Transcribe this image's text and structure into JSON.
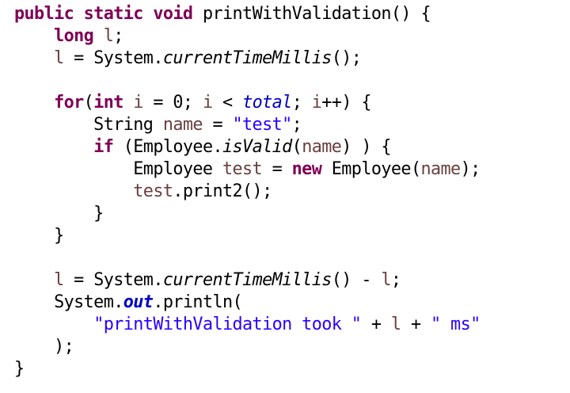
{
  "editor": {
    "lines": [
      [
        {
          "t": "public",
          "c": "kw"
        },
        {
          "t": " "
        },
        {
          "t": "static",
          "c": "kw"
        },
        {
          "t": " "
        },
        {
          "t": "void",
          "c": "kw"
        },
        {
          "t": " printWithValidation() {"
        }
      ],
      [
        {
          "t": "    "
        },
        {
          "t": "long",
          "c": "kw"
        },
        {
          "t": " "
        },
        {
          "t": "l",
          "c": "var"
        },
        {
          "t": ";"
        }
      ],
      [
        {
          "t": "    "
        },
        {
          "t": "l",
          "c": "var"
        },
        {
          "t": " = System."
        },
        {
          "t": "currentTimeMillis",
          "c": "smethod"
        },
        {
          "t": "();"
        }
      ],
      [],
      [
        {
          "t": "    "
        },
        {
          "t": "for",
          "c": "kw"
        },
        {
          "t": "("
        },
        {
          "t": "int",
          "c": "kw"
        },
        {
          "t": " "
        },
        {
          "t": "i",
          "c": "var"
        },
        {
          "t": " = 0; "
        },
        {
          "t": "i",
          "c": "var"
        },
        {
          "t": " < "
        },
        {
          "t": "total",
          "c": "field"
        },
        {
          "t": "; "
        },
        {
          "t": "i",
          "c": "var"
        },
        {
          "t": "++) {"
        }
      ],
      [
        {
          "t": "        String "
        },
        {
          "t": "name",
          "c": "var"
        },
        {
          "t": " = "
        },
        {
          "t": "\"test\"",
          "c": "str"
        },
        {
          "t": ";"
        }
      ],
      [
        {
          "t": "        "
        },
        {
          "t": "if",
          "c": "kw"
        },
        {
          "t": " (Employee."
        },
        {
          "t": "isValid",
          "c": "smethod"
        },
        {
          "t": "("
        },
        {
          "t": "name",
          "c": "var"
        },
        {
          "t": ") ) {"
        }
      ],
      [
        {
          "t": "            Employee "
        },
        {
          "t": "test",
          "c": "var"
        },
        {
          "t": " = "
        },
        {
          "t": "new",
          "c": "kw"
        },
        {
          "t": " Employee("
        },
        {
          "t": "name",
          "c": "var"
        },
        {
          "t": ");"
        }
      ],
      [
        {
          "t": "            "
        },
        {
          "t": "test",
          "c": "var"
        },
        {
          "t": ".print2();"
        }
      ],
      [
        {
          "t": "        }"
        }
      ],
      [
        {
          "t": "    }"
        }
      ],
      [],
      [
        {
          "t": "    "
        },
        {
          "t": "l",
          "c": "var"
        },
        {
          "t": " = System."
        },
        {
          "t": "currentTimeMillis",
          "c": "smethod"
        },
        {
          "t": "() - "
        },
        {
          "t": "l",
          "c": "var"
        },
        {
          "t": ";"
        }
      ],
      [
        {
          "t": "    System."
        },
        {
          "t": "out",
          "c": "sfield"
        },
        {
          "t": ".println("
        }
      ],
      [
        {
          "t": "        "
        },
        {
          "t": "\"printWithValidation took \"",
          "c": "str"
        },
        {
          "t": " + "
        },
        {
          "t": "l",
          "c": "var"
        },
        {
          "t": " + "
        },
        {
          "t": "\" ms\"",
          "c": "str"
        }
      ],
      [
        {
          "t": "    );"
        }
      ],
      [
        {
          "t": "}"
        }
      ]
    ]
  },
  "colors": {
    "keyword": "#7f0055",
    "local_variable": "#6a3e3e",
    "string": "#2a00ff",
    "field": "#0000c0",
    "default": "#000000",
    "background": "#ffffff"
  }
}
